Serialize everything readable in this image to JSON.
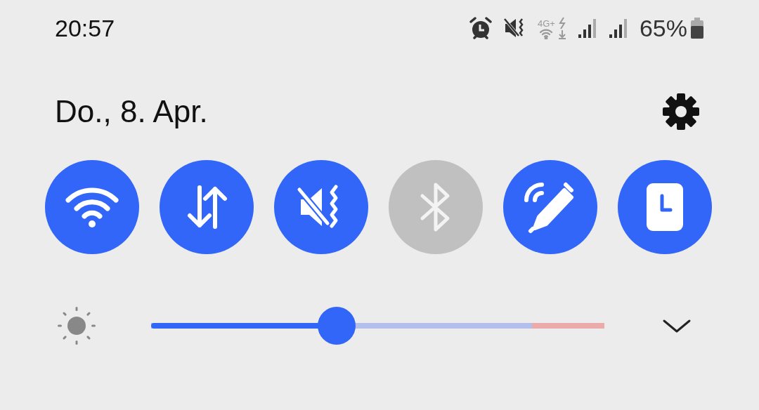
{
  "status_bar": {
    "time": "20:57",
    "network_label": "4G+",
    "battery": "65%"
  },
  "date": "Do., 8. Apr.",
  "toggles": [
    {
      "kind": "wifi",
      "on": true
    },
    {
      "kind": "data",
      "on": true
    },
    {
      "kind": "vibrate",
      "on": true
    },
    {
      "kind": "bluetooth",
      "on": false
    },
    {
      "kind": "pen",
      "on": true
    },
    {
      "kind": "clock",
      "on": true
    }
  ],
  "brightness": {
    "level": 0.41
  }
}
